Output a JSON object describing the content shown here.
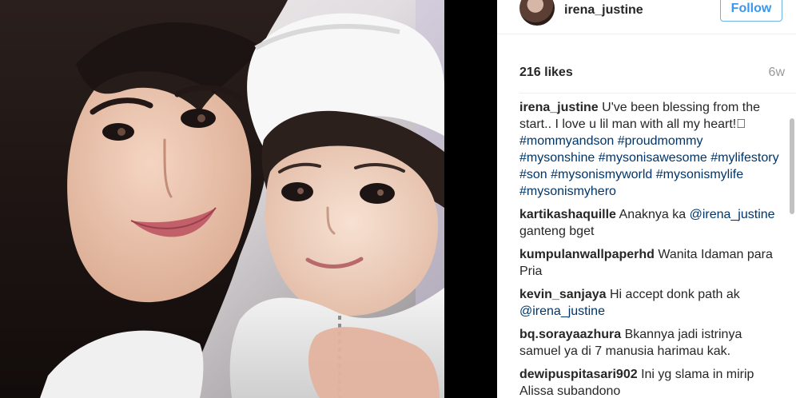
{
  "post": {
    "username": "irena_justine",
    "follow_label": "Follow",
    "likes_text": "216 likes",
    "age_text": "6w"
  },
  "caption": {
    "username": "irena_justine",
    "text": "U've been blessing from the start.. I love u lil man with all my heart!\u0000",
    "tags": [
      "#mommyandson",
      "#proudmommy",
      "#mysonshine",
      "#mysonisawesome",
      "#mylifestory",
      "#son",
      "#mysonismyworld",
      "#mysonismylife",
      "#mysonismyhero"
    ]
  },
  "comments": [
    {
      "username": "kartikashaquille",
      "text_before": "Anaknya ka",
      "mention": "@irena_justine",
      "text_after": "ganteng bget"
    },
    {
      "username": "kumpulanwallpaperhd",
      "text_before": "Wanita Idaman para Pria",
      "mention": "",
      "text_after": ""
    },
    {
      "username": "kevin_sanjaya",
      "text_before": "Hi accept donk path ak",
      "mention": "@irena_justine",
      "text_after": ""
    },
    {
      "username": "bq.sorayaazhura",
      "text_before": "Bkannya jadi istrinya samuel ya di 7 manusia harimau kak.",
      "mention": "",
      "text_after": ""
    },
    {
      "username": "dewipuspitasari902",
      "text_before": "Ini yg slama in mirip Alissa subandono",
      "mention": "",
      "text_after": ""
    }
  ],
  "colors": {
    "link": "#003569",
    "follow": "#3897f0",
    "text": "#262626",
    "muted": "#999999"
  },
  "icons": [
    "avatar"
  ]
}
